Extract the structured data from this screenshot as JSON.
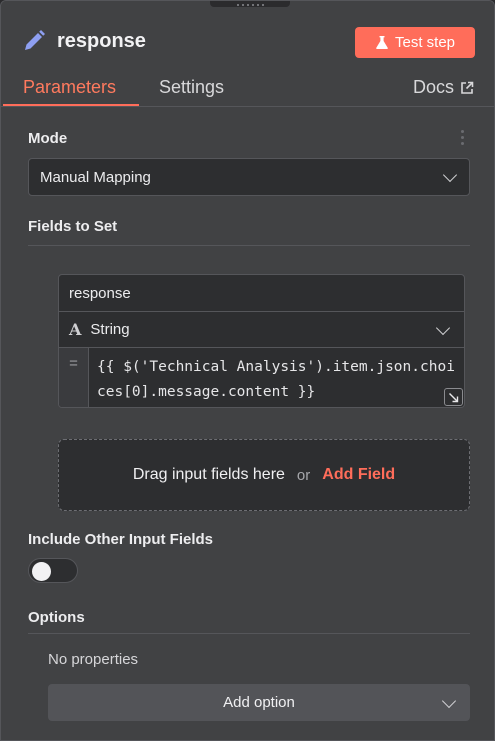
{
  "node": {
    "title": "response",
    "icon": "pencil-icon",
    "test_step_label": "Test step",
    "accent": "#ff6d5a"
  },
  "tabs": {
    "parameters": "Parameters",
    "settings": "Settings",
    "docs": "Docs"
  },
  "mode": {
    "label": "Mode",
    "value": "Manual Mapping"
  },
  "fields_to_set": {
    "label": "Fields to Set",
    "field": {
      "name": "response",
      "type": "String",
      "type_icon_text": "A",
      "gutter": "=",
      "expression": "{{ $('Technical Analysis').item.json.choices[0].message.content }}"
    },
    "dropzone": {
      "text": "Drag input fields here",
      "or": "or",
      "add_field": "Add Field"
    }
  },
  "include_other": {
    "label": "Include Other Input Fields",
    "enabled": false
  },
  "options": {
    "label": "Options",
    "empty_text": "No properties",
    "add_option": "Add option"
  }
}
